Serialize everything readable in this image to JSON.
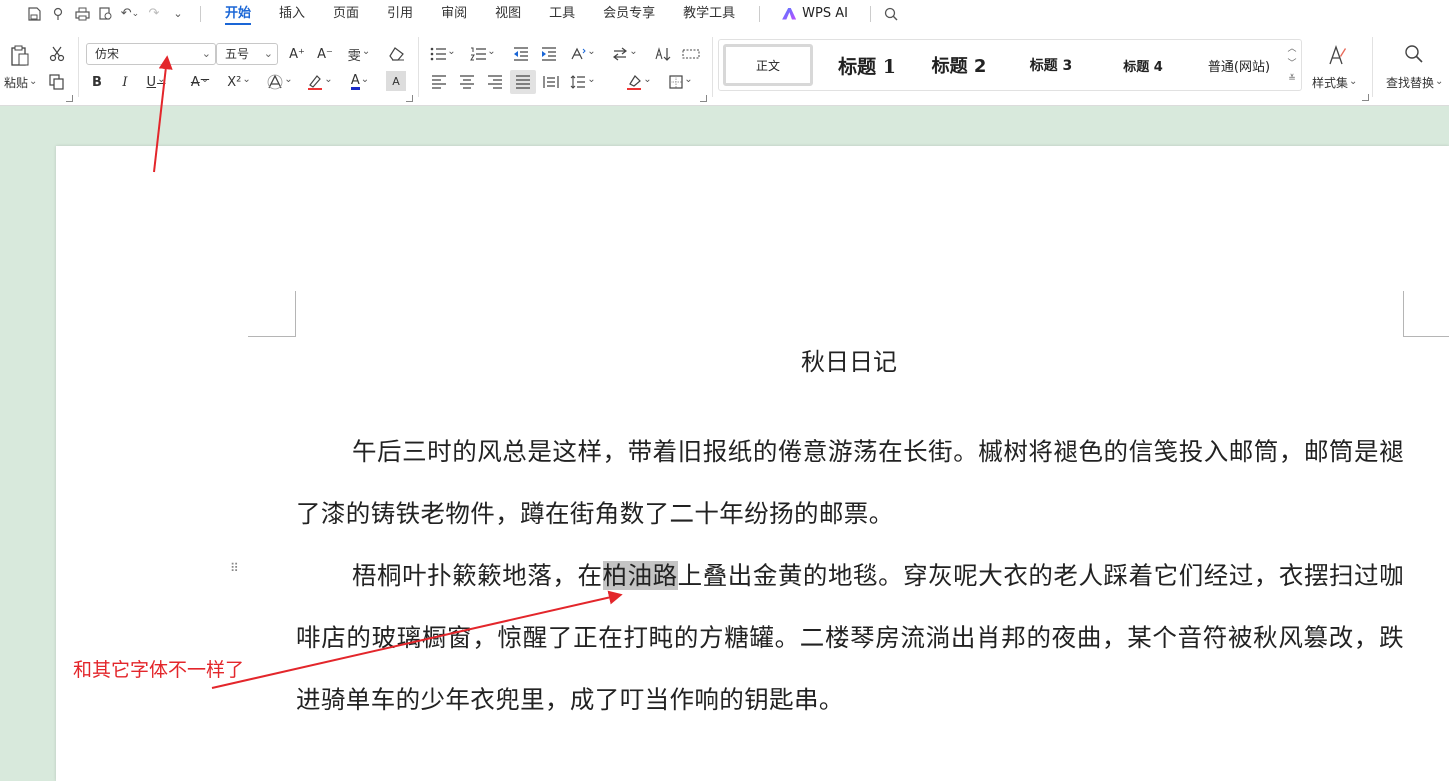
{
  "menubar": {
    "tabs": [
      "开始",
      "插入",
      "页面",
      "引用",
      "审阅",
      "视图",
      "工具",
      "会员专享",
      "教学工具"
    ],
    "active_tab": "开始",
    "ai_label": "WPS AI"
  },
  "ribbon": {
    "paste_label": "粘贴",
    "font_name": "仿宋",
    "font_size": "五号",
    "styles": [
      "正文",
      "标题 1",
      "标题 2",
      "标题 3",
      "标题 4",
      "普通(网站)"
    ],
    "style_set_label": "样式集",
    "find_replace_label": "查找替换",
    "glyphs": {
      "bold": "B",
      "italic": "I",
      "underline": "U",
      "strike": "A",
      "superscript": "X²",
      "font_color": "A",
      "char_shade": "A",
      "grow": "A⁺",
      "shrink": "A⁻",
      "phonetic": "雯"
    }
  },
  "document": {
    "title": "秋日日记",
    "para1": "午后三时的风总是这样，带着旧报纸的倦意游荡在长街。槭树将褪色的信笺投入邮筒，邮筒是褪了漆的铸铁老物件，蹲在街角数了二十年纷扬的邮票。",
    "para2_before": "梧桐叶扑簌簌地落，在",
    "para2_highlight": "柏油路",
    "para2_after": "上叠出金黄的地毯。穿灰呢大衣的老人踩着它们经过，衣摆扫过咖啡店的玻璃橱窗，惊醒了正在打盹的方糖罐。二楼琴房流淌出肖邦的夜曲，某个音符被秋风篡改，跌进骑单车的少年衣兜里，成了叮当作响的钥匙串。"
  },
  "annotation": {
    "text": "和其它字体不一样了",
    "color": "#e3262b"
  },
  "colors": {
    "accent": "#1a66d6",
    "workspace": "#d8e9dc",
    "highlight": "#c4c4c4"
  }
}
